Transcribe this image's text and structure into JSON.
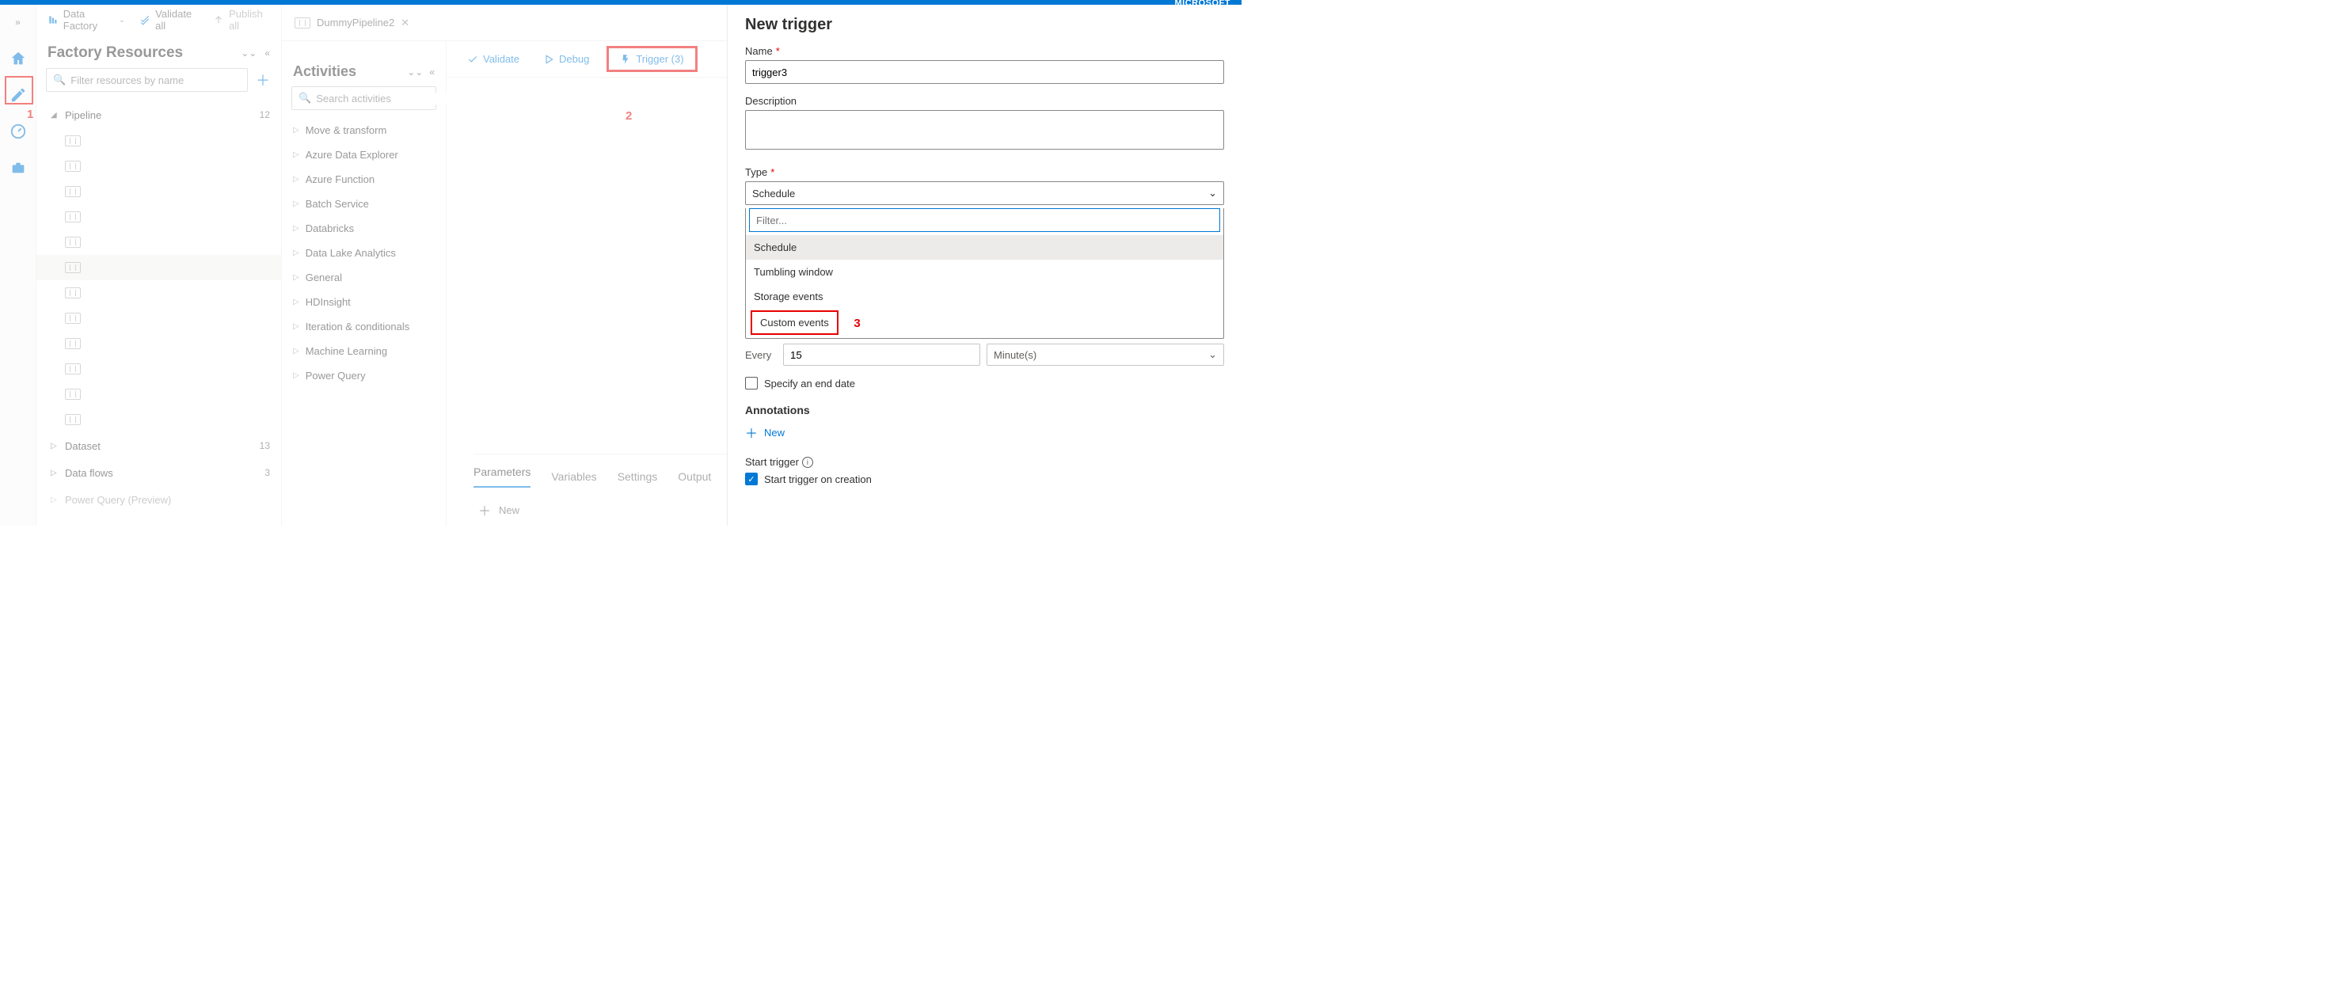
{
  "brand": "MICROSOFT",
  "toolbar": {
    "data_factory": "Data Factory",
    "validate_all": "Validate all",
    "publish_all": "Publish all"
  },
  "annotations": {
    "a1": "1",
    "a2": "2",
    "a3": "3"
  },
  "resources": {
    "title": "Factory Resources",
    "filter_placeholder": "Filter resources by name",
    "pipeline": {
      "label": "Pipeline",
      "count": "12"
    },
    "dataset": {
      "label": "Dataset",
      "count": "13"
    },
    "dataflows": {
      "label": "Data flows",
      "count": "3"
    },
    "powerquery": {
      "label": "Power Query (Preview)",
      "count": ""
    }
  },
  "tab": {
    "name": "DummyPipeline2"
  },
  "activities": {
    "title": "Activities",
    "search_placeholder": "Search activities",
    "items": [
      "Move & transform",
      "Azure Data Explorer",
      "Azure Function",
      "Batch Service",
      "Databricks",
      "Data Lake Analytics",
      "General",
      "HDInsight",
      "Iteration & conditionals",
      "Machine Learning",
      "Power Query"
    ]
  },
  "canvas_toolbar": {
    "validate": "Validate",
    "debug": "Debug",
    "trigger": "Trigger (3)"
  },
  "bottom_tabs": {
    "parameters": "Parameters",
    "variables": "Variables",
    "settings": "Settings",
    "output": "Output",
    "new": "New"
  },
  "trigger_panel": {
    "title": "New trigger",
    "name_label": "Name",
    "name_value": "trigger3",
    "desc_label": "Description",
    "type_label": "Type",
    "type_selected": "Schedule",
    "filter_placeholder": "Filter...",
    "options": {
      "schedule": "Schedule",
      "tumbling": "Tumbling window",
      "storage": "Storage events",
      "custom": "Custom events"
    },
    "every_label": "Every",
    "every_value": "15",
    "every_unit": "Minute(s)",
    "specify_end": "Specify an end date",
    "annotations_label": "Annotations",
    "new_btn": "New",
    "start_trigger_label": "Start trigger",
    "start_trigger_chk": "Start trigger on creation"
  }
}
